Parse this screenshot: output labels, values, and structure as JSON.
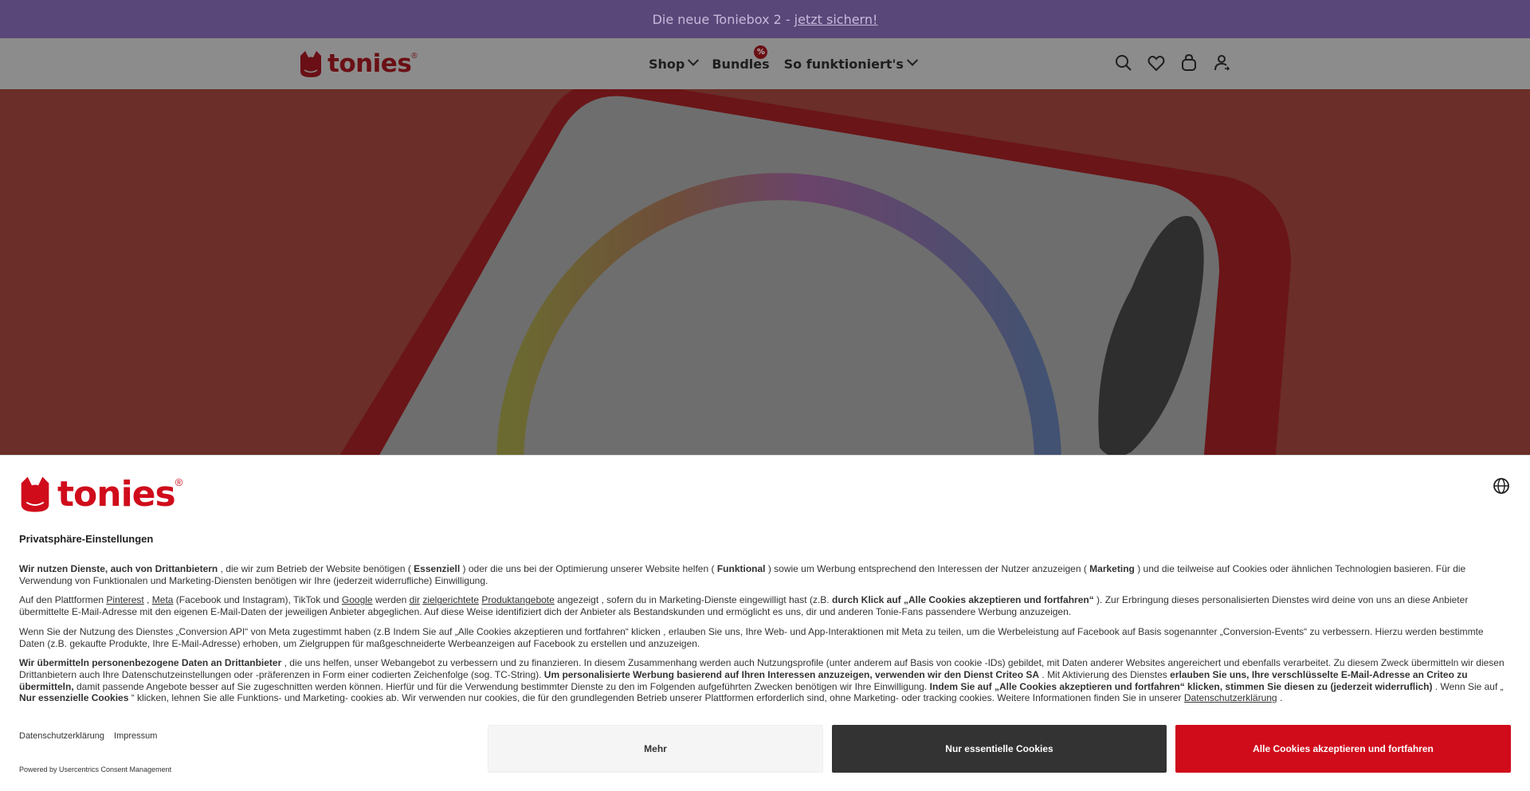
{
  "announcement": {
    "text": "Die neue Toniebox 2 -",
    "link": "jetzt sichern!"
  },
  "header": {
    "logo_text": "tonies",
    "logo_reg": "®",
    "nav": [
      {
        "label": "Shop"
      },
      {
        "label": "Bundles",
        "badge": "%"
      },
      {
        "label": "So funktioniert's"
      }
    ],
    "icons": [
      "search-icon",
      "heart-icon",
      "bag-icon",
      "account-icon"
    ]
  },
  "consent": {
    "logo_text": "tonies",
    "logo_reg": "®",
    "title": "Privatsphäre-Einstellungen",
    "p1": {
      "b1": "Wir nutzen Dienste, auch von Drittanbietern",
      "t1": " , die wir zum Betrieb der Website benötigen ( ",
      "b2": "Essenziell",
      "t2": " ) oder die uns bei der Optimierung unserer Website helfen ( ",
      "b3": "Funktional",
      "t3": " ) sowie um Werbung entsprechend den Interessen der Nutzer anzuzeigen ( ",
      "b4": "Marketing",
      "t4": " ) und die teilweise auf Cookies oder ähnlichen Technologien basieren. Für die Verwendung von Funktionalen und Marketing-Diensten benötigen wir Ihre (jederzeit widerrufliche) Einwilligung."
    },
    "p2": {
      "t1": "Auf den Plattformen ",
      "l1": "Pinterest",
      "t2": " , ",
      "l2": "Meta",
      "t3": " (Facebook und Instagram), TikTok und ",
      "l3": "Google",
      "t4": " werden ",
      "l4": "dir",
      "t5": " ",
      "l5": "zielgerichtete",
      "t6": " ",
      "l6": "Produktangebote",
      "t7": " angezeigt , sofern du in Marketing-Dienste eingewilligt hast (z.B. ",
      "b1": "durch Klick auf „Alle Cookies akzeptieren und fortfahren“",
      "t8": " ). Zur Erbringung dieses personalisierten Dienstes wird deine von uns an diese Anbieter übermittelte E-Mail-Adresse mit den eigenen E-Mail-Daten der jeweiligen Anbieter abgeglichen. Auf diese Weise identifiziert dich der Anbieter als Bestandskunden und ermöglicht es uns, dir und anderen Tonie-Fans passendere Werbung anzuzeigen."
    },
    "p3": "Wenn Sie der Nutzung des Dienstes „Conversion API“ von Meta zugestimmt haben   (z.B   Indem Sie auf „Alle Cookies akzeptieren und fortfahren“ klicken , erlauben Sie uns, Ihre Web- und App-Interaktionen mit Meta zu teilen, um die Werbeleistung auf Facebook auf Basis sogenannter „Conversion-Events“ zu verbessern. Hierzu werden bestimmte Daten (z.B. gekaufte Produkte, Ihre E-Mail-Adresse) erhoben, um Zielgruppen für maßgeschneiderte Werbeanzeigen auf Facebook zu erstellen und anzuzeigen.",
    "p4": {
      "b1": "Wir übermitteln personenbezogene Daten an Drittanbieter",
      "t1": " , die uns helfen, unser Webangebot zu verbessern und zu finanzieren. In diesem Zusammenhang werden auch Nutzungsprofile (unter anderem auf Basis von cookie -IDs) gebildet, mit Daten anderer Websites angereichert und ebenfalls verarbeitet. Zu diesem Zweck übermitteln wir diesen Drittanbietern auch Ihre Datenschutzeinstellungen oder -präferenzen in Form einer codierten Zeichenfolge (sog. TC-String). ",
      "b2": "Um personalisierte Werbung basierend auf Ihren Interessen anzuzeigen, verwenden wir den Dienst Criteo SA",
      "t2": " . Mit Aktivierung des Dienstes ",
      "b3": "erlauben Sie uns, Ihre verschlüsselte E-Mail-Adresse an Criteo zu übermitteln,",
      "t3": " damit passende Angebote besser auf Sie zugeschnitten werden können. Hierfür und für die Verwendung bestimmter Dienste zu den im Folgenden aufgeführten Zwecken benötigen wir Ihre Einwilligung. ",
      "b4": "Indem Sie auf „Alle Cookies akzeptieren und fortfahren“ klicken, stimmen Sie diesen zu (jederzeit widerruflich)",
      "t4": " . Wenn Sie auf „ ",
      "b5": "Nur essenzielle Cookies",
      "t5": " “ klicken, lehnen Sie alle Funktions- und Marketing- cookies ab. Wir verwenden nur cookies, die für den grundlegenden Betrieb unserer Plattformen erforderlich sind, ohne Marketing- oder tracking cookies.   Weitere Informationen finden Sie in unserer ",
      "l1": "Datenschutzerklärung",
      "t6": " ."
    },
    "links": [
      "Datenschutzerklärung",
      "Impressum"
    ],
    "powered": "Powered by Usercentrics Consent Management",
    "buttons": {
      "more": "Mehr",
      "essential": "Nur essentielle Cookies",
      "accept": "Alle Cookies akzeptieren und fortfahren"
    }
  }
}
